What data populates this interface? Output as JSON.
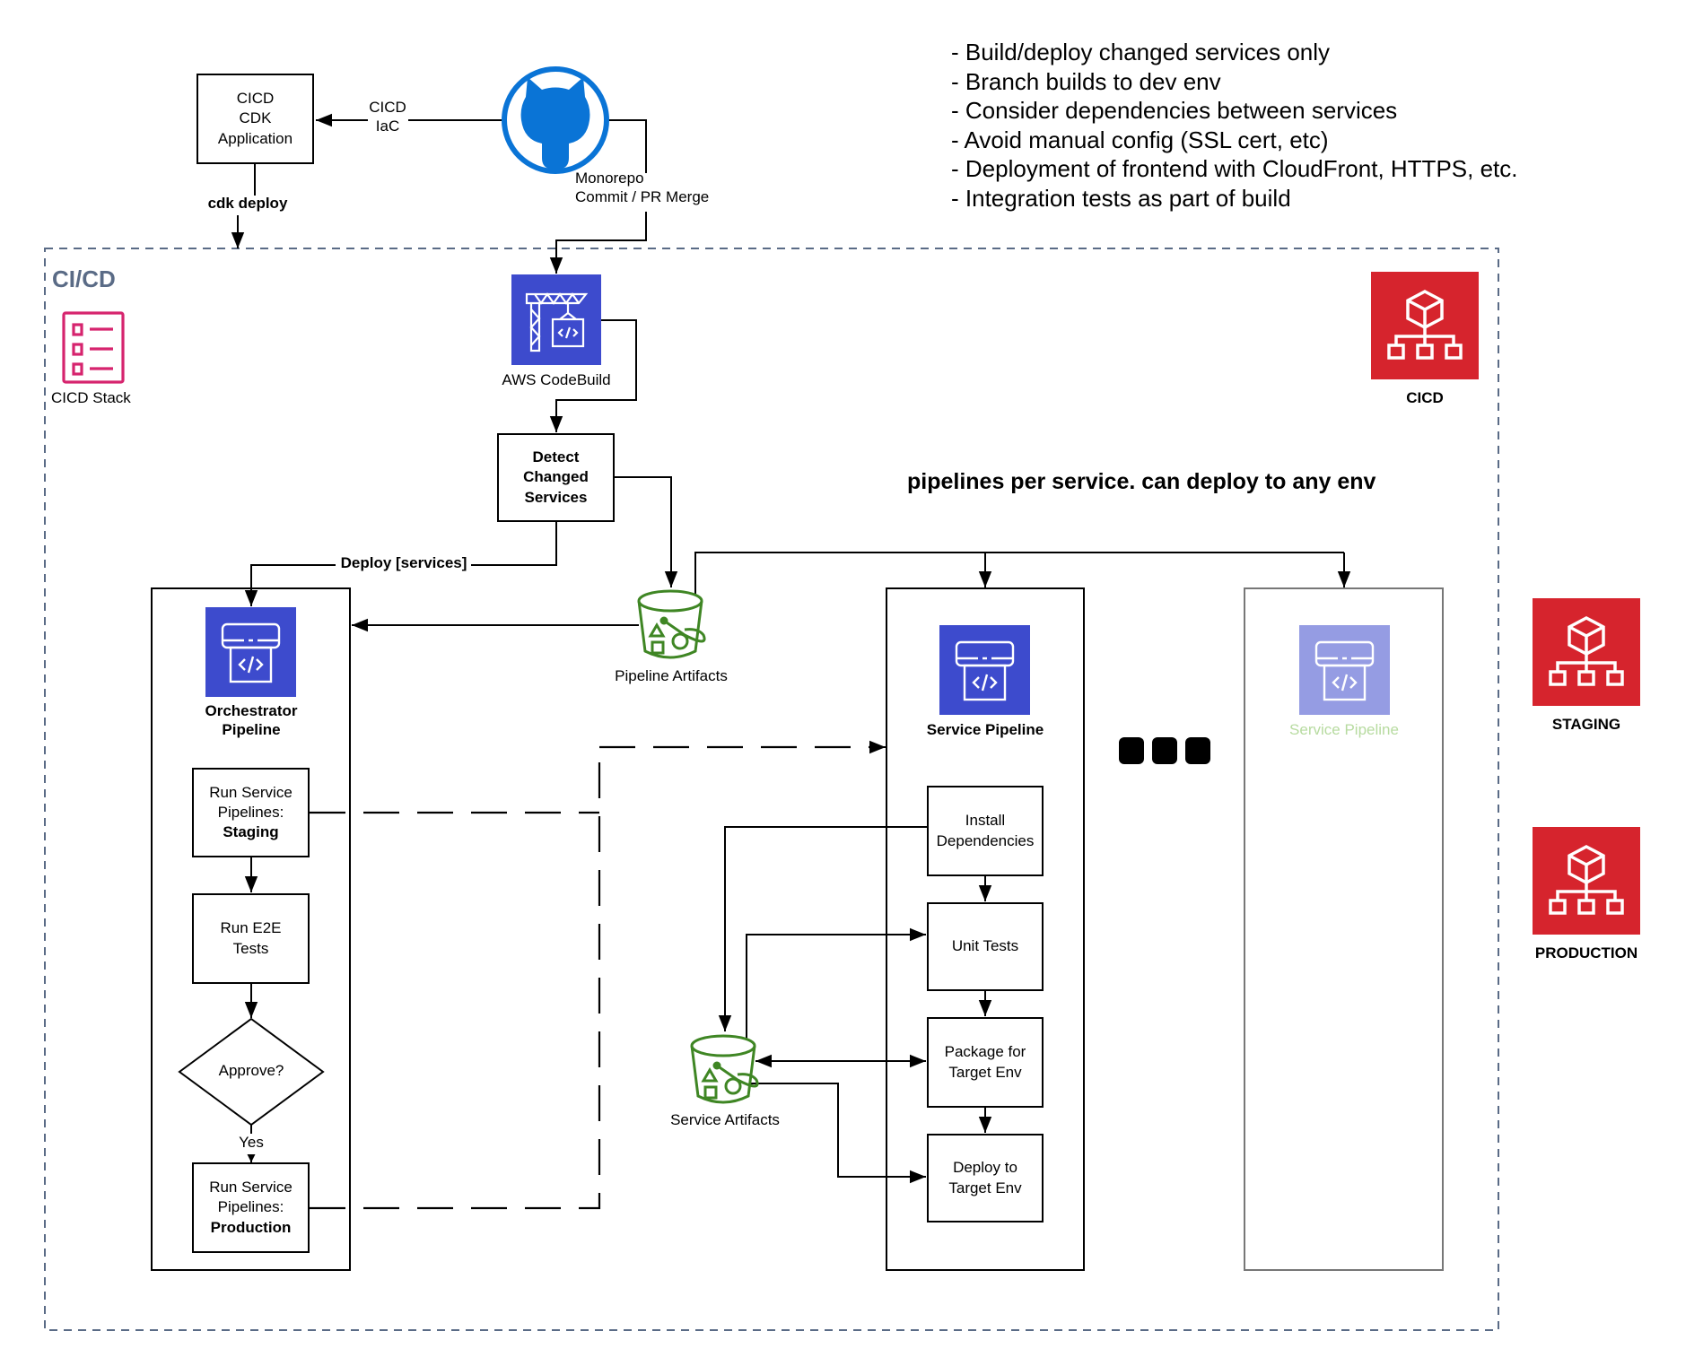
{
  "notes": [
    "- Build/deploy changed services only",
    "- Branch builds to dev env",
    "- Consider dependencies between services",
    "- Avoid manual config (SSL cert, etc)",
    "- Deployment of frontend with CloudFront, HTTPS, etc.",
    "- Integration tests as part of build"
  ],
  "top": {
    "cdk_app": [
      "CICD",
      "CDK",
      "Application"
    ],
    "cicd_iac_label": [
      "CICD",
      "IaC"
    ],
    "cdk_deploy_label": "cdk deploy",
    "monorepo_label": [
      "Monorepo",
      "Commit / PR Merge"
    ],
    "github_icon": "github-octocat-icon"
  },
  "container": {
    "title": "CI/CD",
    "stack_label": "CICD Stack",
    "heading": "pipelines per service. can deploy to any env"
  },
  "codebuild": {
    "label": "AWS CodeBuild"
  },
  "detect": {
    "lines": [
      "Detect",
      "Changed",
      "Services"
    ]
  },
  "deploy_services_label": "Deploy [services]",
  "pipeline_artifacts": {
    "label": "Pipeline Artifacts"
  },
  "orchestrator": {
    "title": [
      "Orchestrator",
      "Pipeline"
    ],
    "staging": {
      "line1": "Run Service",
      "line2": "Pipelines:",
      "env": "Staging"
    },
    "e2e": [
      "Run E2E",
      "Tests"
    ],
    "approve": "Approve?",
    "yes": "Yes",
    "production": {
      "line1": "Run Service",
      "line2": "Pipelines:",
      "env": "Production"
    }
  },
  "service_pipeline": {
    "title": "Service Pipeline",
    "steps": [
      [
        "Install",
        "Dependencies"
      ],
      [
        "Unit Tests"
      ],
      [
        "Package for",
        "Target Env"
      ],
      [
        "Deploy to",
        "Target Env"
      ]
    ]
  },
  "service_artifacts": {
    "label": "Service Artifacts"
  },
  "faded_pipeline": {
    "title": "Service Pipeline"
  },
  "environments": [
    {
      "label": "CICD"
    },
    {
      "label": "STAGING"
    },
    {
      "label": "PRODUCTION"
    }
  ],
  "colors": {
    "github_blue": "#0a74d6",
    "aws_purple": "#3d4bcd",
    "aws_purple_faded": "#959ce3",
    "faded_text": "#b7dba0",
    "s3_green": "#3f8624",
    "account_red": "#d6242d",
    "stack_pink": "#d6246e",
    "container_dash": "#5a6b86"
  }
}
